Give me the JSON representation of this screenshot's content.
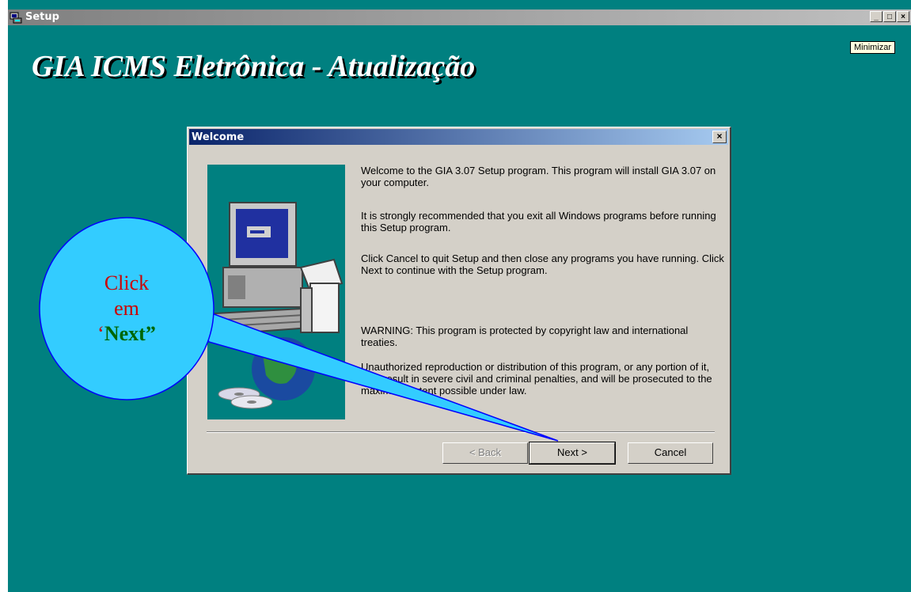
{
  "window": {
    "title": "Setup"
  },
  "caption_buttons": {
    "minimize": "_",
    "maximize": "□",
    "close": "×"
  },
  "tooltip": "Minimizar",
  "banner": "GIA ICMS Eletrônica - Atualização",
  "dialog": {
    "title": "Welcome",
    "close_label": "×",
    "messages": [
      "Welcome to the GIA 3.07 Setup program.  This program will install GIA 3.07 on your computer.",
      "It is strongly recommended that you exit all Windows programs before running this Setup program.",
      "Click Cancel to quit Setup and then close any programs you have running.  Click Next to continue with the Setup program.",
      "WARNING: This program is protected by copyright law and international treaties.",
      "Unauthorized reproduction or distribution of this program, or any portion of it, may result in severe civil and criminal penalties, and will be prosecuted to the maximum extent possible under law."
    ],
    "buttons": {
      "back": "< Back",
      "next": "Next >",
      "cancel": "Cancel"
    }
  },
  "callout": {
    "line1": "Click",
    "line2": "em",
    "line3_quote": "‘",
    "line3_word": "Next”",
    "colors": {
      "fill": "#33ccff",
      "line1": "#cc0000",
      "line3": "#006600"
    }
  },
  "colors": {
    "desktop": "#008080",
    "dialog_title_start": "#0a246a",
    "dialog_title_end": "#a6caf0",
    "face": "#d4d0c8"
  }
}
